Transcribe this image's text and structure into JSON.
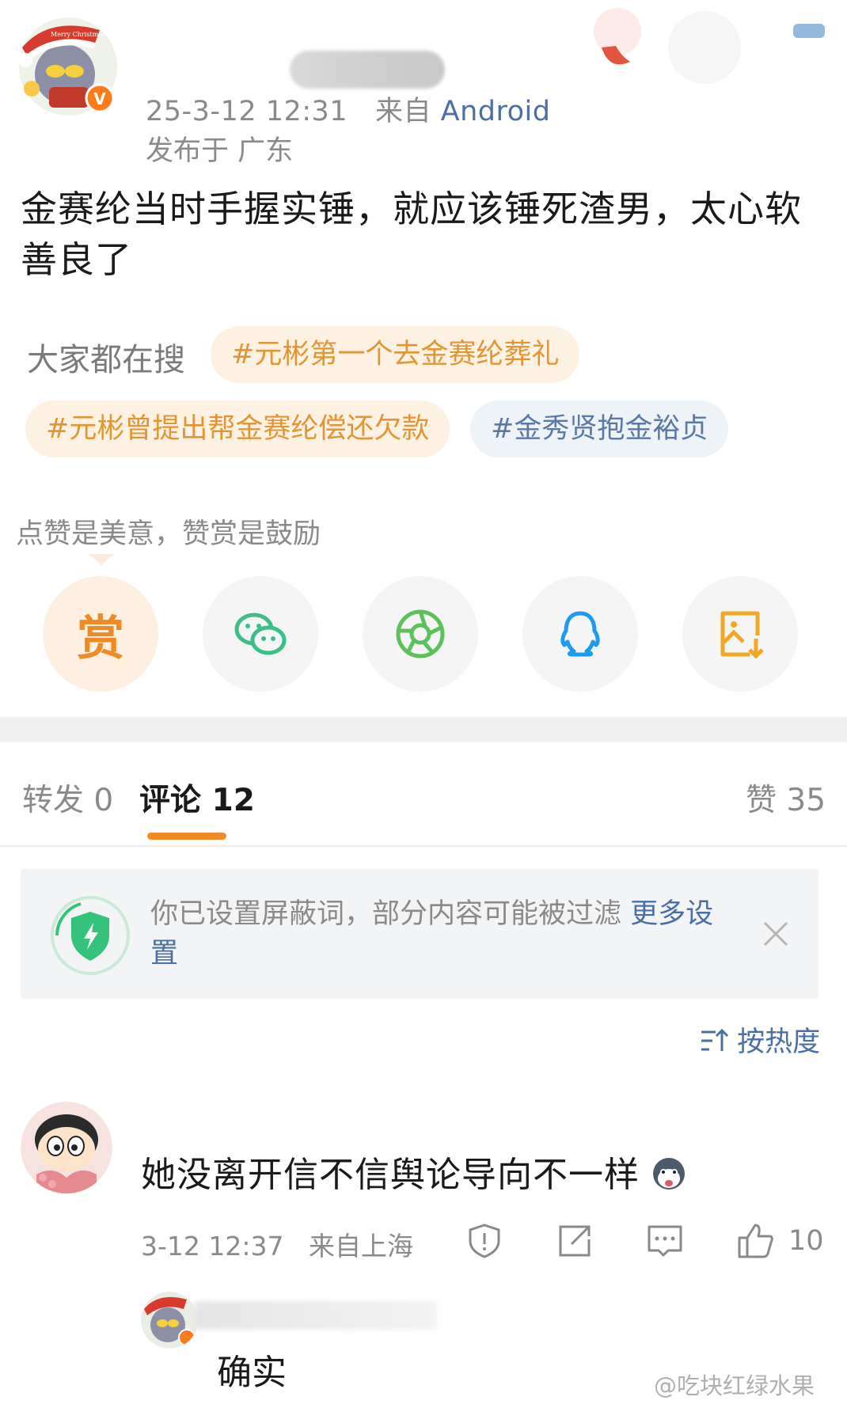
{
  "post": {
    "meta_time": "25-3-12 12:31",
    "meta_from": "来自",
    "meta_source": "Android",
    "meta_location": "发布于 广东",
    "text": "金赛纶当时手握实锤，就应该锤死渣男，太心软善良了",
    "avatar_badge": "V",
    "avatar_hat_text": "Merry Christmas"
  },
  "search": {
    "label": "大家都在搜",
    "tags": [
      {
        "text": "#元彬第一个去金赛纶葬礼",
        "color": "orange"
      },
      {
        "text": "#元彬曾提出帮金赛纶偿还欠款",
        "color": "orange"
      },
      {
        "text": "#金秀贤抱金裕贞",
        "color": "blue"
      }
    ]
  },
  "praise": {
    "text": "点赞是美意，赞赏是鼓励",
    "buttons": [
      {
        "icon": "reward-icon",
        "glyph": "赏"
      },
      {
        "icon": "wechat-icon"
      },
      {
        "icon": "moments-icon"
      },
      {
        "icon": "qq-icon"
      },
      {
        "icon": "save-image-icon"
      }
    ]
  },
  "tabs": {
    "repost": "转发 0",
    "comment": "评论 12",
    "like": "赞 35"
  },
  "notice": {
    "text": "你已设置屏蔽词，部分内容可能被过滤 ",
    "link": "更多设置"
  },
  "sort": {
    "label": "按热度"
  },
  "comment": {
    "text": "她没离开信不信舆论导向不一样",
    "time": "3-12 12:37",
    "location": "来自上海",
    "likes": "10"
  },
  "reply": {
    "text": "确实"
  },
  "watermark": "@吃块红绿水果",
  "colors": {
    "accent_orange": "#f08a24",
    "link_blue": "#4a6fa8",
    "tag_orange_bg": "#fdf1e2",
    "tag_blue_bg": "#eef3f8"
  }
}
